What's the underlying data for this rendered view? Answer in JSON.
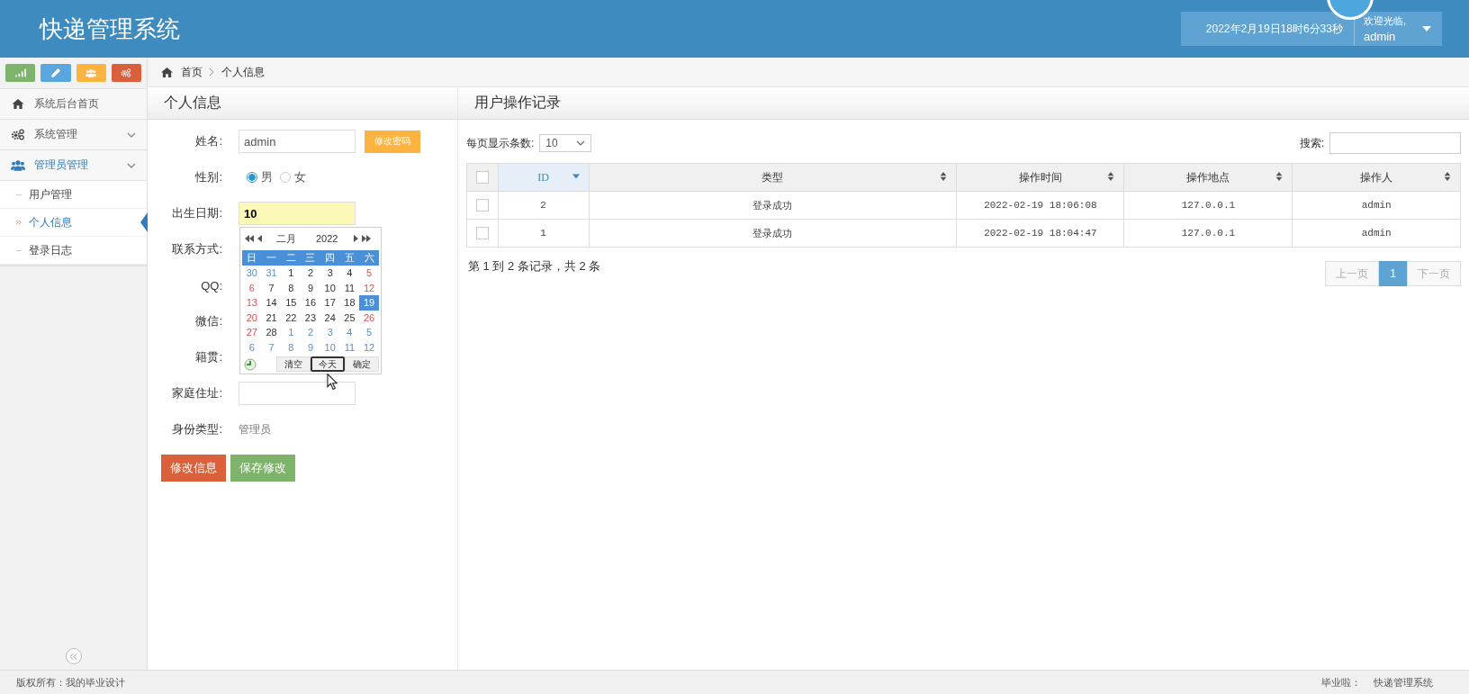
{
  "header": {
    "title": "快递管理系统",
    "datetime": "2022年2月19日18时6分33秒",
    "welcome": "欢迎光临,",
    "user": "admin"
  },
  "sidebar": {
    "toolbar": [
      {
        "kind": "chart",
        "color": "#7db36a"
      },
      {
        "kind": "pencil",
        "color": "#5aa6e0"
      },
      {
        "kind": "users",
        "color": "#fdb340"
      },
      {
        "kind": "gears",
        "color": "#d9603b"
      }
    ],
    "items": [
      {
        "label": "系统后台首页",
        "selected": false
      },
      {
        "label": "系统管理",
        "selected": false
      },
      {
        "label": "管理员管理",
        "selected": true,
        "children": [
          {
            "label": "用户管理",
            "selected": false
          },
          {
            "label": "个人信息",
            "selected": true
          },
          {
            "label": "登录日志",
            "selected": false
          }
        ]
      }
    ]
  },
  "breadcrumb": [
    "首页",
    "个人信息"
  ],
  "profile": {
    "title": "个人信息",
    "fields": [
      {
        "kind": "text",
        "label": "姓名:",
        "value": "admin",
        "action": "修改密码"
      },
      {
        "kind": "radio",
        "label": "性别:",
        "options": [
          {
            "label": "男",
            "selected": true
          },
          {
            "label": "女",
            "selected": false
          }
        ]
      },
      {
        "kind": "date",
        "label": "出生日期:",
        "value": "10"
      },
      {
        "kind": "covered",
        "label": "联系方式:"
      },
      {
        "kind": "covered",
        "label": "QQ:"
      },
      {
        "kind": "covered",
        "label": "微信:"
      },
      {
        "kind": "covered",
        "label": "籍贯:"
      },
      {
        "kind": "text",
        "label": "家庭住址:"
      },
      {
        "kind": "static",
        "label": "身份类型:",
        "value": "管理员"
      }
    ],
    "buttons": [
      {
        "label": "修改信息",
        "kind": "edit"
      },
      {
        "label": "保存修改",
        "kind": "save"
      }
    ],
    "calendar": {
      "month": "二月",
      "year": "2022",
      "weekdays": [
        "日",
        "一",
        "二",
        "三",
        "四",
        "五",
        "六"
      ],
      "weeks": [
        [
          {
            "day": "30",
            "kind": "other",
            "selected": false
          },
          {
            "day": "31",
            "kind": "other",
            "selected": false
          },
          {
            "day": "1",
            "kind": "weekday",
            "selected": false
          },
          {
            "day": "2",
            "kind": "weekday",
            "selected": false
          },
          {
            "day": "3",
            "kind": "weekday",
            "selected": false
          },
          {
            "day": "4",
            "kind": "weekday",
            "selected": false
          },
          {
            "day": "5",
            "kind": "weekend",
            "selected": false
          }
        ],
        [
          {
            "day": "6",
            "kind": "weekend",
            "selected": false
          },
          {
            "day": "7",
            "kind": "weekday",
            "selected": false
          },
          {
            "day": "8",
            "kind": "weekday",
            "selected": false
          },
          {
            "day": "9",
            "kind": "weekday",
            "selected": false
          },
          {
            "day": "10",
            "kind": "weekday",
            "selected": false
          },
          {
            "day": "11",
            "kind": "weekday",
            "selected": false
          },
          {
            "day": "12",
            "kind": "weekend",
            "selected": false
          }
        ],
        [
          {
            "day": "13",
            "kind": "weekend",
            "selected": false
          },
          {
            "day": "14",
            "kind": "weekday",
            "selected": false
          },
          {
            "day": "15",
            "kind": "weekday",
            "selected": false
          },
          {
            "day": "16",
            "kind": "weekday",
            "selected": false
          },
          {
            "day": "17",
            "kind": "weekday",
            "selected": false
          },
          {
            "day": "18",
            "kind": "weekday",
            "selected": false
          },
          {
            "day": "19",
            "kind": "weekend",
            "selected": true
          }
        ],
        [
          {
            "day": "20",
            "kind": "weekend",
            "selected": false
          },
          {
            "day": "21",
            "kind": "weekday",
            "selected": false
          },
          {
            "day": "22",
            "kind": "weekday",
            "selected": false
          },
          {
            "day": "23",
            "kind": "weekday",
            "selected": false
          },
          {
            "day": "24",
            "kind": "weekday",
            "selected": false
          },
          {
            "day": "25",
            "kind": "weekday",
            "selected": false
          },
          {
            "day": "26",
            "kind": "weekend",
            "selected": false
          }
        ],
        [
          {
            "day": "27",
            "kind": "weekend",
            "selected": false
          },
          {
            "day": "28",
            "kind": "weekday",
            "selected": false
          },
          {
            "day": "1",
            "kind": "other",
            "selected": false
          },
          {
            "day": "2",
            "kind": "other",
            "selected": false
          },
          {
            "day": "3",
            "kind": "other",
            "selected": false
          },
          {
            "day": "4",
            "kind": "other",
            "selected": false
          },
          {
            "day": "5",
            "kind": "other",
            "selected": false
          }
        ],
        [
          {
            "day": "6",
            "kind": "other",
            "selected": false
          },
          {
            "day": "7",
            "kind": "other",
            "selected": false
          },
          {
            "day": "8",
            "kind": "other",
            "selected": false
          },
          {
            "day": "9",
            "kind": "other",
            "selected": false
          },
          {
            "day": "10",
            "kind": "other",
            "selected": false
          },
          {
            "day": "11",
            "kind": "other",
            "selected": false
          },
          {
            "day": "12",
            "kind": "other",
            "selected": false
          }
        ]
      ],
      "buttons": [
        {
          "label": "清空",
          "focused": false
        },
        {
          "label": "今天",
          "focused": true
        },
        {
          "label": "确定",
          "focused": false
        }
      ]
    }
  },
  "log": {
    "title": "用户操作记录",
    "page_size_label": "每页显示条数:",
    "page_size": "10",
    "search_label": "搜索:",
    "all_checked": false,
    "columns": [
      {
        "label": "ID",
        "sorted": true
      },
      {
        "label": "类型",
        "sorted": false
      },
      {
        "label": "操作时间",
        "sorted": false
      },
      {
        "label": "操作地点",
        "sorted": false
      },
      {
        "label": "操作人",
        "sorted": false
      }
    ],
    "rows": [
      {
        "checked": false,
        "cells": [
          "2",
          "登录成功",
          "2022-02-19 18:06:08",
          "127.0.0.1",
          "admin"
        ]
      },
      {
        "checked": false,
        "cells": [
          "1",
          "登录成功",
          "2022-02-19 18:04:47",
          "127.0.0.1",
          "admin"
        ]
      }
    ],
    "summary": "第 1 到 2 条记录，共 2 条",
    "pagination": [
      {
        "label": "上一页",
        "selected": false,
        "disabled": true
      },
      {
        "label": "1",
        "selected": true,
        "disabled": false
      },
      {
        "label": "下一页",
        "selected": false,
        "disabled": true
      }
    ]
  },
  "footer": {
    "copyright": "版权所有：我的毕业设计",
    "right_label": "毕业啦：",
    "right_value": "快递管理系统"
  }
}
